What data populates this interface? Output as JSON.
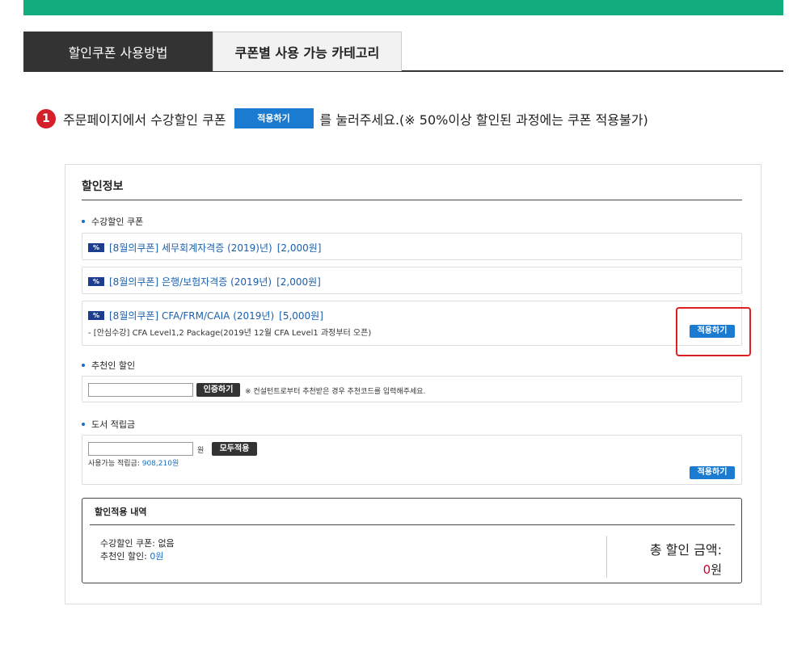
{
  "colors": {
    "accent_green": "#12ad7e",
    "tab_dark": "#333333",
    "button_blue": "#1a7bd1",
    "highlight_red": "#e02020",
    "step_red": "#d51f2a",
    "link_blue": "#1a5fae",
    "total_red": "#c8002b"
  },
  "tabs": [
    {
      "label": "할인쿠폰 사용방법",
      "active": true
    },
    {
      "label": "쿠폰별 사용 가능 카테고리",
      "active": false
    }
  ],
  "step": {
    "number": "1",
    "text_before": "주문페이지에서 수강할인 쿠폰",
    "button_label": "적용하기",
    "text_after": "를 눌러주세요.(※  50%이상 할인된 과정에는 쿠폰 적용불가)"
  },
  "panel": {
    "title": "할인정보",
    "coupon_section": {
      "label": "수강할인 쿠폰",
      "icon": "coupon-icon",
      "icon_text": "%",
      "coupons": [
        {
          "name": "[8월의쿠폰] 세무회계자격증 (2019)년)",
          "amount": "[2,000원]"
        },
        {
          "name": "[8월의쿠폰] 은행/보험자격증 (2019년)",
          "amount": "[2,000원]"
        },
        {
          "name": "[8월의쿠폰] CFA/FRM/CAIA (2019년)",
          "amount": "[5,000원]",
          "sub": "- [안심수강] CFA Level1,2 Package(2019년 12월 CFA Level1 과정부터 오픈)",
          "apply_label": "적용하기"
        }
      ]
    },
    "referral": {
      "label": "추천인 할인",
      "input_value": "",
      "verify_label": "인증하기",
      "note": "※ 컨설턴트로부터 추천받은 경우 추천코드를 입력해주세요."
    },
    "points": {
      "label": "도서 적립금",
      "input_value": "",
      "unit": "원",
      "apply_all_label": "모두적용",
      "available_label": "사용가능 적립금:",
      "available_value": "908,210원",
      "apply_label": "적용하기"
    },
    "summary": {
      "title": "할인적용 내역",
      "coupon_line_label": "수강할인 쿠폰:",
      "coupon_line_value": "없음",
      "referral_line_label": "추천인 할인:",
      "referral_line_value": "0원",
      "total_label": "총 할인 금액:",
      "total_value": "0",
      "total_unit": "원"
    }
  }
}
